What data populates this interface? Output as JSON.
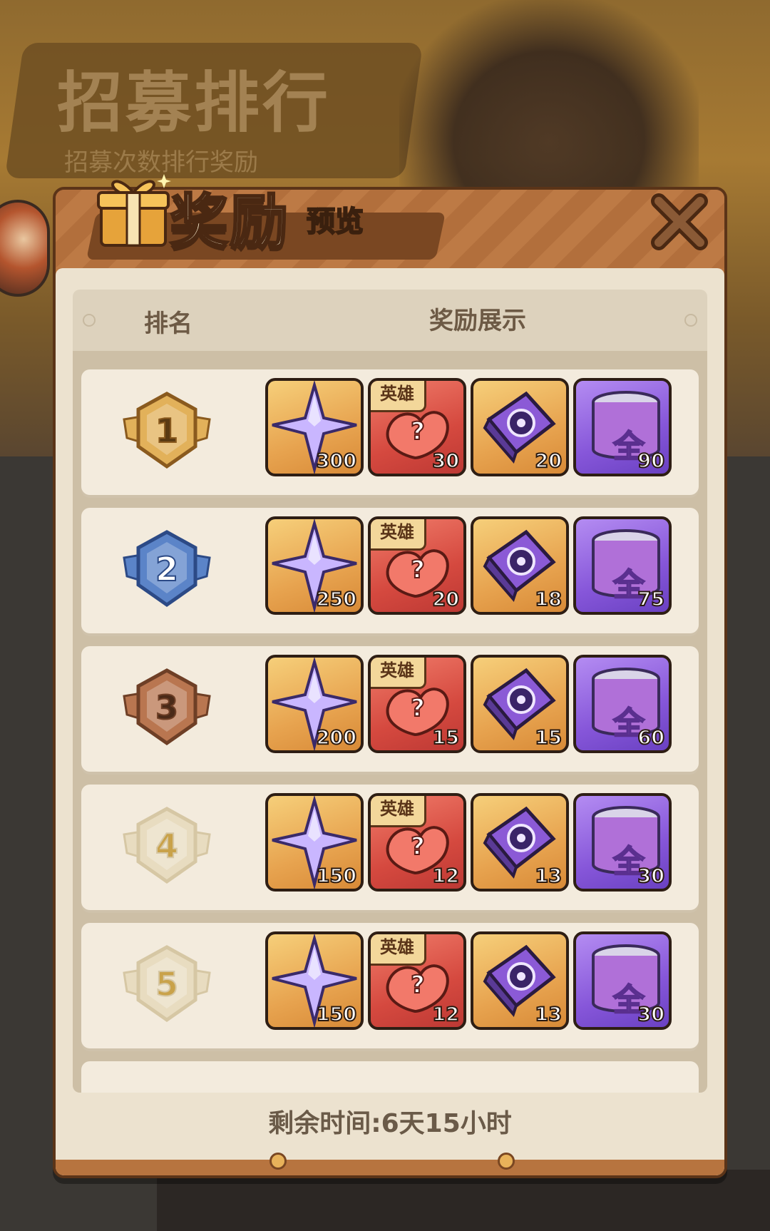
{
  "background": {
    "banner_title": "招募排行",
    "banner_subtitle": "招募次数排行奖励"
  },
  "dialog": {
    "title_main": "奖励",
    "title_sub": "预览",
    "columns": {
      "rank": "排名",
      "reward": "奖励展示"
    },
    "hero_tag": "英雄",
    "can_label": "全",
    "footer": "剩余时间:6天15小时"
  },
  "ranks": [
    {
      "rank": "1",
      "star_qty": "300",
      "hero_qty": "30",
      "card_qty": "20",
      "can_qty": "90"
    },
    {
      "rank": "2",
      "star_qty": "250",
      "hero_qty": "20",
      "card_qty": "18",
      "can_qty": "75"
    },
    {
      "rank": "3",
      "star_qty": "200",
      "hero_qty": "15",
      "card_qty": "15",
      "can_qty": "60"
    },
    {
      "rank": "4",
      "star_qty": "150",
      "hero_qty": "12",
      "card_qty": "13",
      "can_qty": "30"
    },
    {
      "rank": "5",
      "star_qty": "150",
      "hero_qty": "12",
      "card_qty": "13",
      "can_qty": "30"
    }
  ],
  "colors": {
    "gold_medal": "#e2b15a",
    "silver_medal": "#5b84c8",
    "bronze_medal": "#b97650",
    "plain_medal": "#e8dcc0"
  }
}
